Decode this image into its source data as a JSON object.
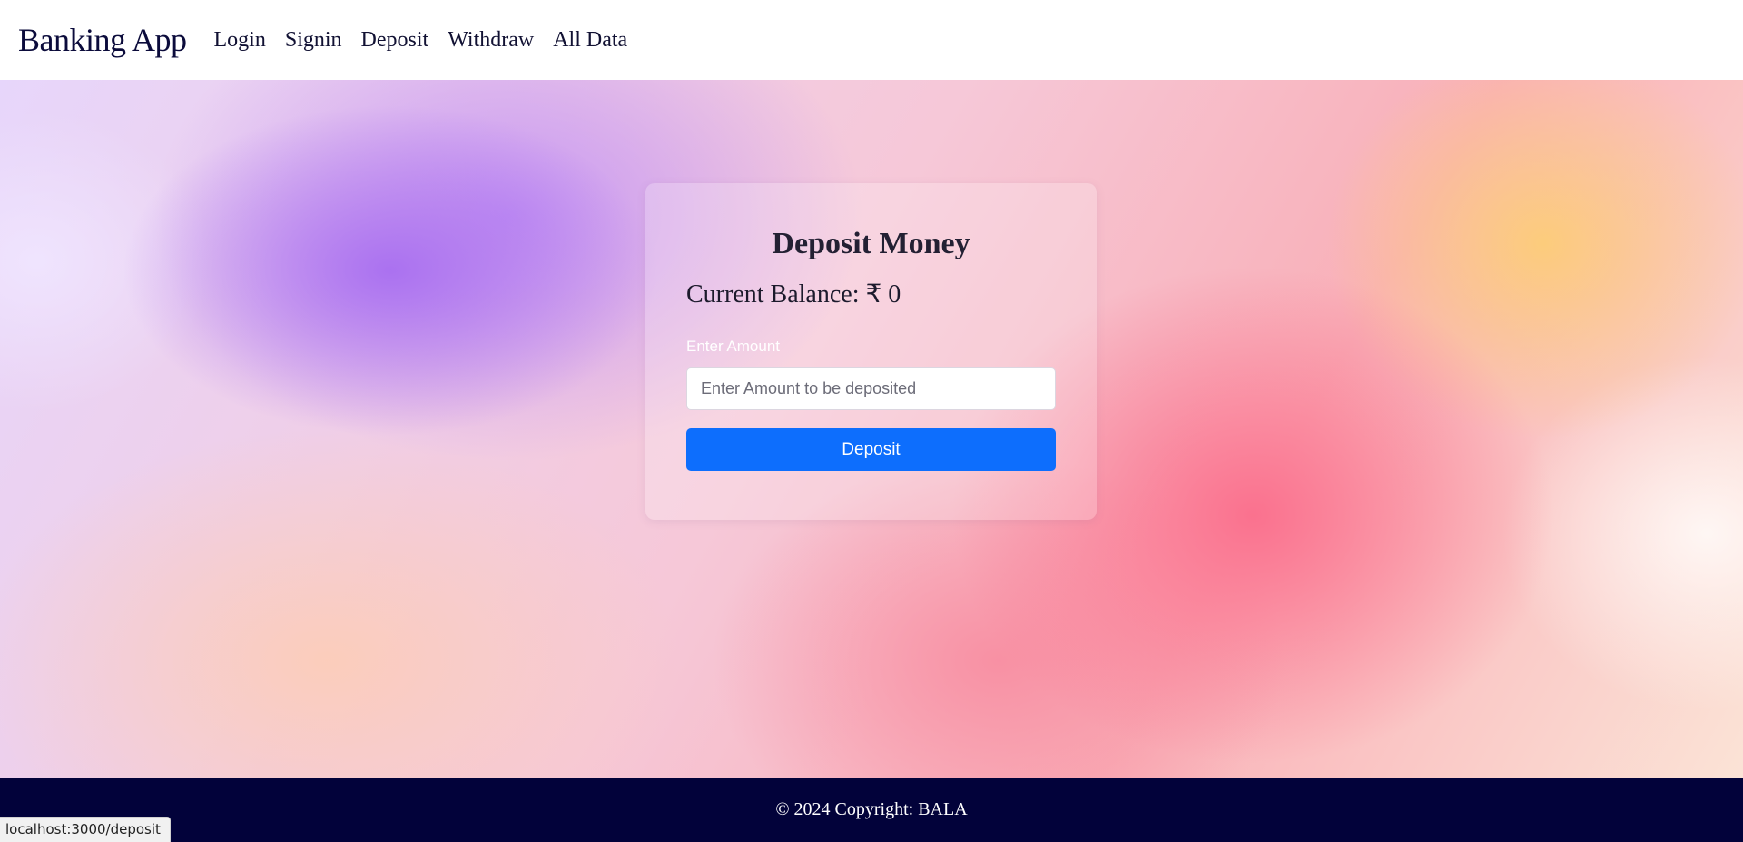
{
  "navbar": {
    "brand": "Banking App",
    "links": [
      "Login",
      "Signin",
      "Deposit",
      "Withdraw",
      "All Data"
    ]
  },
  "card": {
    "title": "Deposit Money",
    "balance_label": "Current Balance: ₹ 0",
    "amount_label": "Enter Amount",
    "amount_value": "",
    "amount_placeholder": "Enter Amount to be deposited",
    "submit_label": "Deposit"
  },
  "footer": {
    "text": "© 2024 Copyright: BALA"
  },
  "status_bar": {
    "url": "localhost:3000/deposit"
  },
  "colors": {
    "primary_button": "#0d6efd",
    "footer_bg": "#02023a",
    "brand_text": "#0b0b3b"
  }
}
